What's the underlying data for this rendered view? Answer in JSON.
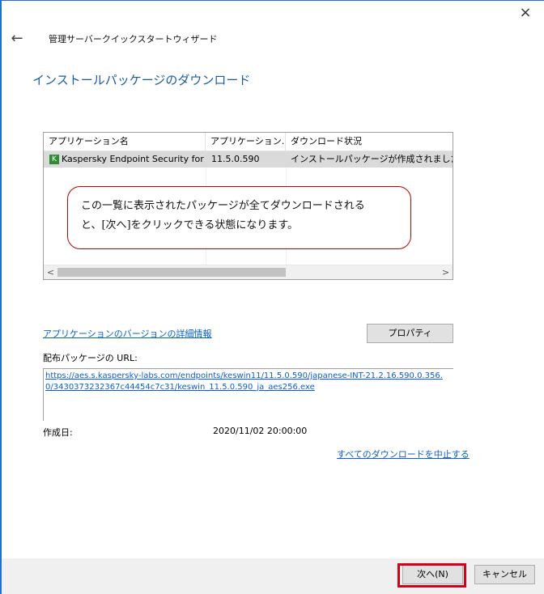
{
  "window": {
    "close_icon": "×",
    "back_icon": "←",
    "title": "管理サーバークイックスタートウィザード"
  },
  "page": {
    "heading": "インストールパッケージのダウンロード"
  },
  "table": {
    "columns": [
      "アプリケーション名",
      "アプリケーション…",
      "ダウンロード状況"
    ],
    "rows": [
      {
        "name": "Kaspersky Endpoint Security for …",
        "version": "11.5.0.590",
        "status": "インストールパッケージが作成されました",
        "icon": "kaspersky-app-icon"
      }
    ],
    "scroll_left": "<",
    "scroll_right": ">"
  },
  "callout": {
    "line1": "この一覧に表示されたパッケージが全てダウンロードされる",
    "line2": "と、[次へ]をクリックできる状態になります。"
  },
  "details": {
    "version_link": "アプリケーションのバージョンの詳細情報",
    "properties_button": "プロパティ",
    "url_label": "配布パッケージの URL:",
    "url": "https://aes.s.kaspersky-labs.com/endpoints/keswin11/11.5.0.590/japanese-INT-21.2.16.590.0.356.0/3430373232367c44454c7c31/keswin_11.5.0.590_ja_aes256.exe",
    "created_label": "作成日:",
    "created_value": "2020/11/02 20:00:00",
    "stop_all_link": "すべてのダウンロードを中止する"
  },
  "footer": {
    "next_button": "次へ(N)",
    "cancel_button": "キャンセル"
  },
  "colors": {
    "accent": "#1a5ba6",
    "link": "#0b5fc7",
    "highlight": "#d4001a"
  }
}
